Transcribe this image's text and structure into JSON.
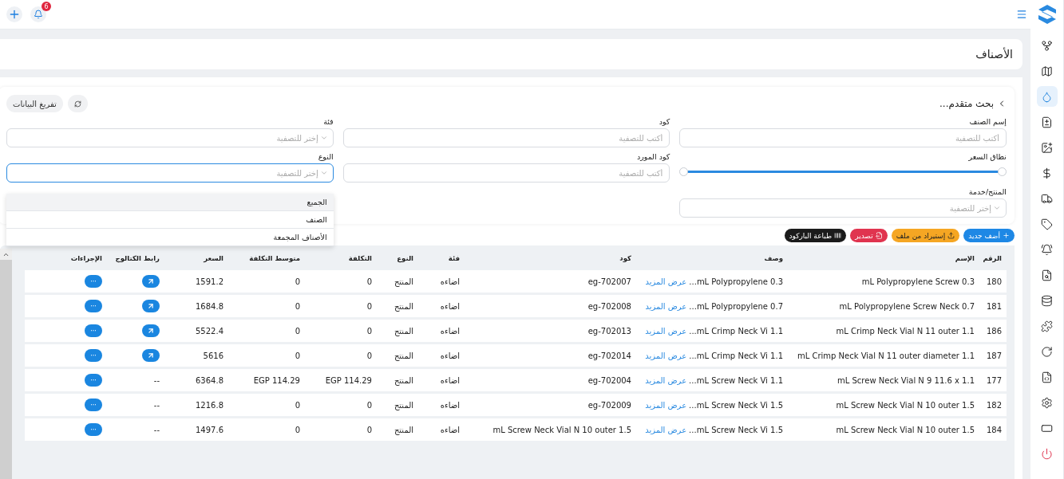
{
  "topbar": {
    "notifications": "6"
  },
  "sidebar": {
    "items": [
      {
        "selected": false
      },
      {
        "selected": false
      },
      {
        "selected": true
      },
      {
        "selected": false
      },
      {
        "selected": false
      },
      {
        "selected": false
      },
      {
        "selected": false
      },
      {
        "selected": false
      },
      {
        "selected": false
      },
      {
        "selected": false
      },
      {
        "selected": false
      },
      {
        "selected": false
      },
      {
        "selected": false
      },
      {
        "selected": false
      },
      {
        "selected": false
      },
      {
        "selected": false
      },
      {
        "selected": false
      }
    ]
  },
  "page": {
    "title": "الأصناف"
  },
  "filters": {
    "title": "بحث متقدم...",
    "clear_button": "تفريغ البيانات",
    "rows": [
      [
        {
          "kind": "text",
          "label": "إسم الصنف",
          "placeholder": "أكتب للتصفية"
        },
        {
          "kind": "text",
          "label": "كود",
          "placeholder": "أكتب للتصفية"
        },
        {
          "kind": "select",
          "label": "فئة",
          "placeholder": "إختر للتصفية",
          "open": false
        }
      ],
      [
        {
          "kind": "range",
          "label": "نطاق السعر",
          "thumbs": [
            {
              "level": 0
            },
            {
              "level": 1
            }
          ]
        },
        {
          "kind": "text",
          "label": "كود المورد",
          "placeholder": "أكتب للتصفية"
        },
        {
          "kind": "select",
          "label": "النوع",
          "placeholder": "إختر للتصفية",
          "open": true,
          "options": [
            {
              "label": "الجميع",
              "selected": true
            },
            {
              "label": "الصنف",
              "selected": false
            },
            {
              "label": "الأصناف المجمعة",
              "selected": false
            }
          ]
        }
      ],
      [
        {
          "kind": "select",
          "label": "المنتج/خدمة",
          "placeholder": "إختر للتصفية",
          "open": false
        }
      ]
    ]
  },
  "actions": [
    {
      "kind": "add",
      "label": "أضف جديد"
    },
    {
      "kind": "import",
      "label": "إستيراد من ملف"
    },
    {
      "kind": "export",
      "label": "تصدير"
    },
    {
      "kind": "barcode",
      "label": "طباعة الباركود"
    }
  ],
  "table": {
    "columns": [
      "الرقم",
      "الإسم",
      "وصف",
      "كود",
      "فئة",
      "النوع",
      "التكلفة",
      "متوسط التكلفة",
      "السعر",
      "رابط الكتالوج",
      "الإجراءات"
    ],
    "rows": [
      {
        "number": "180",
        "name": "mL Polypropylene Screw 0.3",
        "description": "0.3 mL Polypropylene...",
        "more": "عرض المزيد",
        "code": "eg-702007",
        "category": "اضاءه",
        "type": "المنتج",
        "cost": "0",
        "avg_cost": "0",
        "price": "1591.2",
        "catalog": {
          "kind": "link"
        },
        "actions": "···"
      },
      {
        "number": "181",
        "name": "mL Polypropylene Screw Neck 0.7",
        "description": "0.7 mL Polypropylene...",
        "more": "عرض المزيد",
        "code": "eg-702008",
        "category": "اضاءه",
        "type": "المنتج",
        "cost": "0",
        "avg_cost": "0",
        "price": "1684.8",
        "catalog": {
          "kind": "link"
        },
        "actions": "···"
      },
      {
        "number": "186",
        "name": "mL Crimp Neck Vial N 11 outer 1.1",
        "description": "1.1 mL Crimp Neck Vi...",
        "more": "عرض المزيد",
        "code": "eg-702013",
        "category": "اضاءه",
        "type": "المنتج",
        "cost": "0",
        "avg_cost": "0",
        "price": "5522.4",
        "catalog": {
          "kind": "link"
        },
        "actions": "···"
      },
      {
        "number": "187",
        "name": "mL Crimp Neck Vial N 11 outer diameter 1.1",
        "description": "1.1 mL Crimp Neck Vi...",
        "more": "عرض المزيد",
        "code": "eg-702014",
        "category": "اضاءه",
        "type": "المنتج",
        "cost": "0",
        "avg_cost": "0",
        "price": "5616",
        "catalog": {
          "kind": "link"
        },
        "actions": "···"
      },
      {
        "number": "177",
        "name": "mL Screw Neck Vial N 9 11.6 x 1.1",
        "description": "1.1 mL Screw Neck Vi...",
        "more": "عرض المزيد",
        "code": "eg-702004",
        "category": "اضاءه",
        "type": "المنتج",
        "cost": "EGP 114.29",
        "avg_cost": "EGP 114.29",
        "price": "6364.8",
        "catalog": {
          "kind": "text",
          "text": "--"
        },
        "actions": "···"
      },
      {
        "number": "182",
        "name": "mL Screw Neck Vial N 10 outer 1.5",
        "description": "1.5 mL Screw Neck Vi...",
        "more": "عرض المزيد",
        "code": "eg-702009",
        "category": "اضاءه",
        "type": "المنتج",
        "cost": "0",
        "avg_cost": "0",
        "price": "1216.8",
        "catalog": {
          "kind": "text",
          "text": "--"
        },
        "actions": "···"
      },
      {
        "number": "184",
        "name": "mL Screw Neck Vial N 10 outer 1.5",
        "description": "1.5 mL Screw Neck Vi...",
        "more": "عرض المزيد",
        "code": "mL Screw Neck Vial N 10 outer 1.5",
        "category": "اضاءه",
        "type": "المنتج",
        "cost": "0",
        "avg_cost": "0",
        "price": "1497.6",
        "catalog": {
          "kind": "text",
          "text": "--"
        },
        "actions": "···"
      }
    ]
  }
}
